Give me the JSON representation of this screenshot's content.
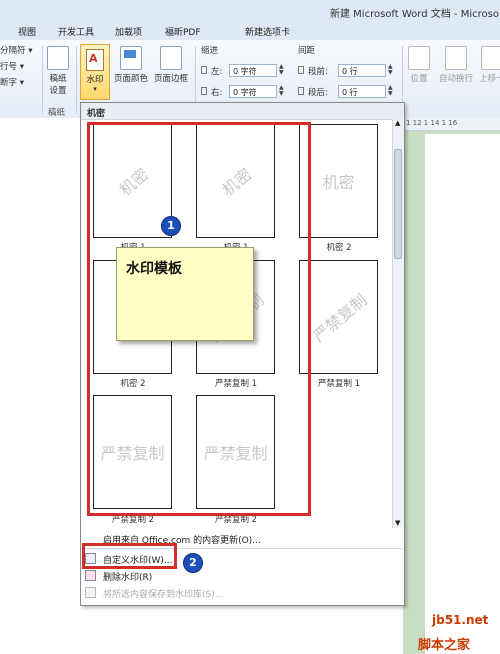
{
  "window": {
    "title": "新建 Microsoft Word 文档 - Microso"
  },
  "tabs": [
    "视图",
    "开发工具",
    "加载项",
    "福昕PDF",
    "新建选项卡"
  ],
  "ribbon": {
    "left_items": [
      "分隔符 ▾",
      "行号 ▾",
      "断字 ▾"
    ],
    "draft_button": "稿纸\n设置",
    "draft_group_label": "稿纸",
    "watermark_button": "水印",
    "page_color_button": "页面颜色",
    "page_border_button": "页面边框",
    "indent_label": "缩进",
    "indent_left_label": "左:",
    "indent_left_value": "0 字符",
    "indent_right_label": "右:",
    "indent_right_value": "0 字符",
    "spacing_label": "间距",
    "spacing_before_label": "段前:",
    "spacing_before_value": "0 行",
    "spacing_after_label": "段后:",
    "spacing_after_value": "0 行",
    "position_button": "位置",
    "wrap_button": "自动换行",
    "bring_forward_button": "上移一"
  },
  "dropdown": {
    "header": "机密",
    "thumbnails": [
      {
        "wm": "机密",
        "caption": "机密 1",
        "diag": true
      },
      {
        "wm": "机密",
        "caption": "机密 1",
        "diag": true
      },
      {
        "wm": "机密",
        "caption": "机密 2",
        "diag": false
      },
      {
        "wm": "机密",
        "caption": "机密 2",
        "diag": false
      },
      {
        "wm": "严禁复制",
        "caption": "严禁复制 1",
        "diag": true
      },
      {
        "wm": "严禁复制",
        "caption": "严禁复制 1",
        "diag": true
      },
      {
        "wm": "严禁复制",
        "caption": "严禁复制 2",
        "diag": false
      },
      {
        "wm": "严禁复制",
        "caption": "严禁复制 2",
        "diag": false
      }
    ],
    "office_update": "启用来自 Office.com 的内容更新(O)...",
    "menu": {
      "custom": "自定义水印(W)...",
      "remove": "删除水印(R)",
      "save": "将所选内容保存到水印库(S)..."
    }
  },
  "annotation": {
    "note": "水印模板",
    "badge1": "1",
    "badge2": "2"
  },
  "ruler_text": "1 12 1 14 1 16",
  "site_watermark": {
    "line1": "jb51.net",
    "line2": "脚本之家"
  },
  "colors": {
    "highlight": "#d42b2b",
    "badge": "#1d4fb8",
    "note": "#ffffc6",
    "doc_bg": "#c9ddc2"
  }
}
